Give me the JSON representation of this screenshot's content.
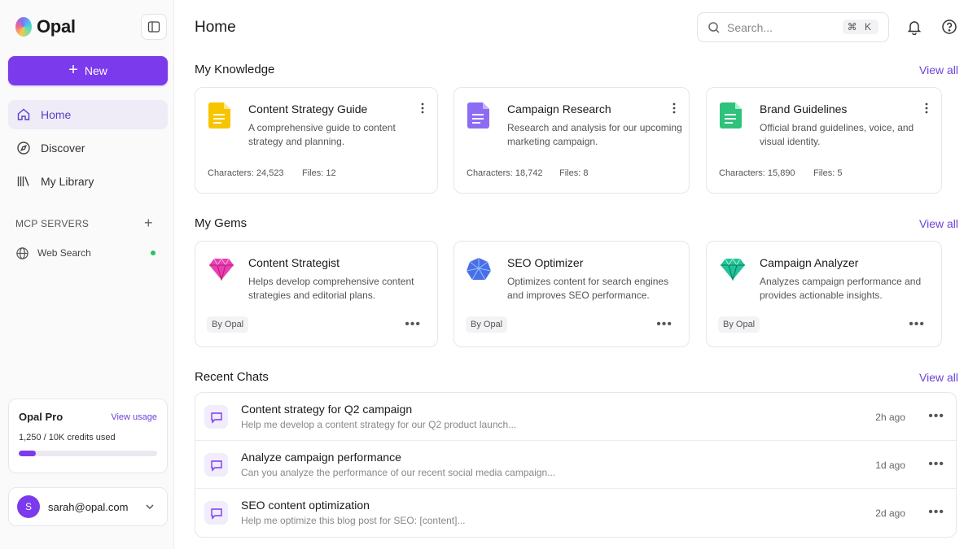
{
  "app": {
    "name": "Opal"
  },
  "sidebar": {
    "new_label": "New",
    "nav": [
      {
        "label": "Home",
        "icon": "home-icon",
        "active": true
      },
      {
        "label": "Discover",
        "icon": "compass-icon",
        "active": false
      },
      {
        "label": "My Library",
        "icon": "library-icon",
        "active": false
      }
    ],
    "servers_label": "MCP SERVERS",
    "servers": [
      {
        "label": "Web Search",
        "status": "connected",
        "status_color": "#22c55e"
      }
    ],
    "plan": {
      "title": "Opal Pro",
      "usage_link": "View usage",
      "credits": "1,250 / 10K credits used",
      "progress": 0.125
    },
    "user": {
      "initial": "S",
      "email": "sarah@opal.com"
    }
  },
  "header": {
    "title": "Home",
    "search_placeholder": "Search...",
    "search_shortcut": "⌘ K"
  },
  "sections": {
    "knowledge": {
      "title": "My Knowledge",
      "view_all": "View all"
    },
    "gems": {
      "title": "My Gems",
      "view_all": "View all"
    },
    "chats": {
      "title": "Recent Chats",
      "view_all": "View all"
    }
  },
  "knowledge": [
    {
      "title": "Content Strategy Guide",
      "desc": "A comprehensive guide to content strategy and planning.",
      "characters": "Characters: 24,523",
      "files": "Files: 12",
      "color": "#f7c500"
    },
    {
      "title": "Campaign Research",
      "desc": "Research and analysis for our upcoming marketing campaign.",
      "characters": "Characters: 18,742",
      "files": "Files: 8",
      "color": "#8b6cf2"
    },
    {
      "title": "Brand Guidelines",
      "desc": "Official brand guidelines, voice, and visual identity.",
      "characters": "Characters: 15,890",
      "files": "Files: 5",
      "color": "#2fc27a"
    }
  ],
  "gems": [
    {
      "title": "Content Strategist",
      "desc": "Helps develop comprehensive content strategies and editorial plans.",
      "badge": "By Opal",
      "color": "#e63fb8"
    },
    {
      "title": "SEO Optimizer",
      "desc": "Optimizes content for search engines and improves SEO performance.",
      "badge": "By Opal",
      "color": "#4a6ee8"
    },
    {
      "title": "Campaign Analyzer",
      "desc": "Analyzes campaign performance and provides actionable insights.",
      "badge": "By Opal",
      "color": "#22c39a"
    }
  ],
  "chats": [
    {
      "title": "Content strategy for Q2 campaign",
      "preview": "Help me develop a content strategy for our Q2 product launch...",
      "time": "2h ago"
    },
    {
      "title": "Analyze campaign performance",
      "preview": "Can you analyze the performance of our recent social media campaign...",
      "time": "1d ago"
    },
    {
      "title": "SEO content optimization",
      "preview": "Help me optimize this blog post for SEO: [content]...",
      "time": "2d ago"
    }
  ],
  "colors": {
    "accent": "#7c3aed",
    "link": "#6d42d8"
  }
}
